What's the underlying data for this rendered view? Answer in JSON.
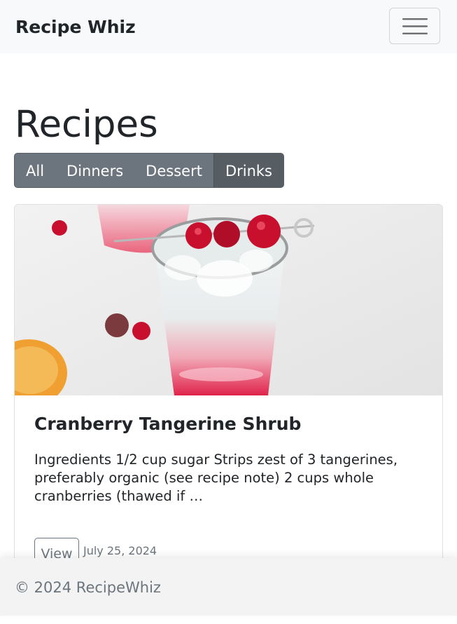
{
  "navbar": {
    "brand": "Recipe Whiz",
    "toggler_icon": "hamburger-menu-icon"
  },
  "main": {
    "title": "Recipes",
    "filters": [
      {
        "label": "All",
        "active": false
      },
      {
        "label": "Dinners",
        "active": false
      },
      {
        "label": "Dessert",
        "active": false
      },
      {
        "label": "Drinks",
        "active": true
      }
    ]
  },
  "recipe": {
    "title": "Cranberry Tangerine Shrub",
    "excerpt": "Ingredients 1/2 cup sugar Strips zest of 3 tangerines, preferably organic (see recipe note) 2 cups whole cranberries (thawed if …",
    "view_label": "View",
    "date": "July 25, 2024"
  },
  "footer": {
    "text": "© 2024 RecipeWhiz"
  },
  "colors": {
    "navbar_bg": "#f8f9fa",
    "secondary": "#6c757d",
    "secondary_active": "#565e64",
    "cranberry": "#c8102e"
  }
}
